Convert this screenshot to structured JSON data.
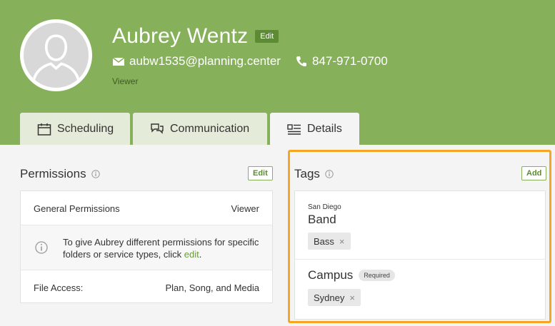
{
  "profile": {
    "name": "Aubrey Wentz",
    "edit_label": "Edit",
    "email": "aubw1535@planning.center",
    "phone": "847-971-0700",
    "role": "Viewer"
  },
  "tabs": [
    {
      "label": "Scheduling",
      "icon": "calendar-icon",
      "active": false
    },
    {
      "label": "Communication",
      "icon": "chat-icon",
      "active": false
    },
    {
      "label": "Details",
      "icon": "details-icon",
      "active": true
    }
  ],
  "permissions": {
    "title": "Permissions",
    "edit_label": "Edit",
    "rows": [
      {
        "label": "General Permissions",
        "value": "Viewer"
      },
      {
        "note_prefix": "To give Aubrey different permissions for specific folders or service types, click ",
        "note_link": "edit",
        "note_suffix": "."
      },
      {
        "label": "File Access:",
        "value": "Plan, Song, and Media"
      }
    ]
  },
  "tags": {
    "title": "Tags",
    "add_label": "Add",
    "groups": [
      {
        "subtitle": "San Diego",
        "name": "Band",
        "badge": "",
        "chips": [
          "Bass"
        ]
      },
      {
        "subtitle": "",
        "name": "Campus",
        "badge": "Required",
        "chips": [
          "Sydney"
        ]
      }
    ]
  },
  "colors": {
    "header_green": "#86b15a",
    "accent_green": "#5d8b35",
    "highlight_orange": "#f5a623"
  }
}
